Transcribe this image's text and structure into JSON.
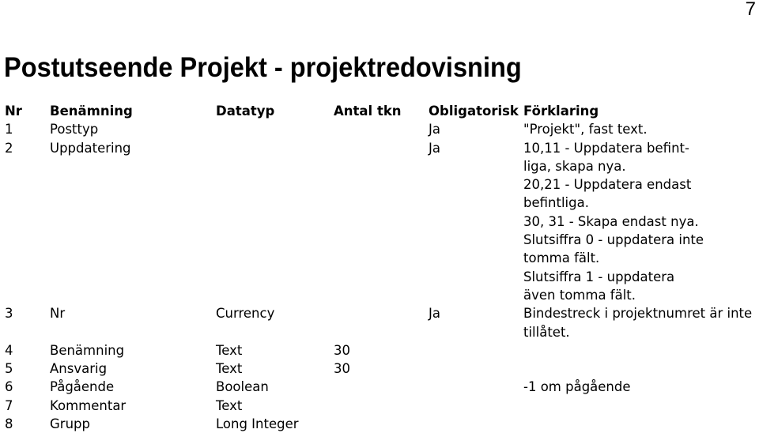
{
  "page_number": "7",
  "title": "Postutseende Projekt - projektredovisning",
  "table": {
    "headers": {
      "nr": "Nr",
      "benamning": "Benämning",
      "datatyp": "Datatyp",
      "antal_tkn": "Antal tkn",
      "obligatorisk": "Obligatorisk",
      "forklaring": "Förklaring"
    },
    "rows": [
      {
        "nr": "1",
        "benamning": "Posttyp",
        "datatyp": "",
        "antal_tkn": "",
        "obligatorisk": "Ja",
        "forklaring": [
          "\"Projekt\", fast text."
        ]
      },
      {
        "nr": "2",
        "benamning": "Uppdatering",
        "datatyp": "",
        "antal_tkn": "",
        "obligatorisk": "Ja",
        "forklaring": [
          "10,11 - Uppdatera befint-",
          "liga, skapa nya.",
          "20,21 - Uppdatera endast",
          "befintliga.",
          "30, 31 - Skapa endast nya.",
          "Slutsiffra 0 - uppdatera inte",
          "tomma fält.",
          "Slutsiffra 1 - uppdatera",
          "även tomma fält."
        ]
      },
      {
        "nr": "3",
        "benamning": "Nr",
        "datatyp": "Currency",
        "antal_tkn": "",
        "obligatorisk": "Ja",
        "forklaring": [
          "Bindestreck i projektnumret är inte",
          "tillåtet."
        ]
      },
      {
        "nr": "4",
        "benamning": "Benämning",
        "datatyp": "Text",
        "antal_tkn": "30",
        "obligatorisk": "",
        "forklaring": []
      },
      {
        "nr": "5",
        "benamning": "Ansvarig",
        "datatyp": "Text",
        "antal_tkn": "30",
        "obligatorisk": "",
        "forklaring": []
      },
      {
        "nr": "6",
        "benamning": "Pågående",
        "datatyp": "Boolean",
        "antal_tkn": "",
        "obligatorisk": "",
        "forklaring": [
          "-1 om pågående"
        ]
      },
      {
        "nr": "7",
        "benamning": "Kommentar",
        "datatyp": "Text",
        "antal_tkn": "",
        "obligatorisk": "",
        "forklaring": []
      },
      {
        "nr": "8",
        "benamning": "Grupp",
        "datatyp": "Long Integer",
        "antal_tkn": "",
        "obligatorisk": "",
        "forklaring": []
      }
    ]
  }
}
